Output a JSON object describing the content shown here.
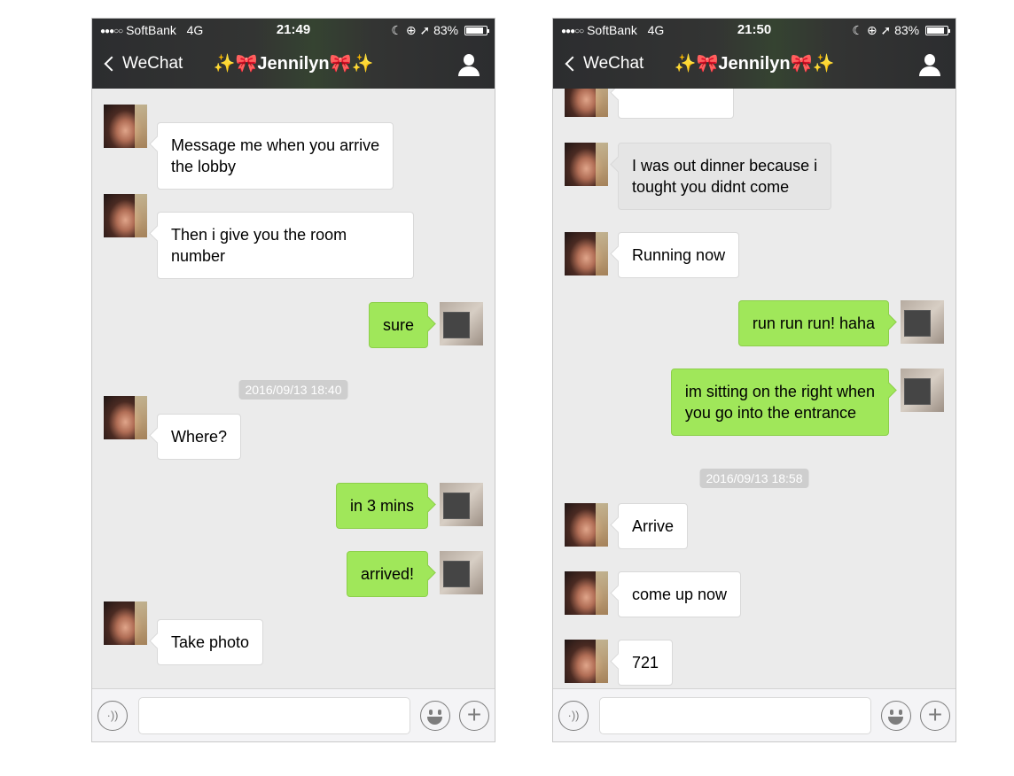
{
  "status_bar": {
    "carrier": "SoftBank",
    "network": "4G",
    "battery": "83%",
    "battery_level": 0.83
  },
  "screens": [
    {
      "time": "21:49",
      "nav": {
        "back_label": "WeChat",
        "title": "Jennilyn"
      },
      "messages": [
        {
          "from": "contact",
          "text": [
            "Message me when you arrive",
            "the lobby"
          ]
        },
        {
          "from": "contact",
          "text": [
            "Then i give you the room",
            "number"
          ]
        },
        {
          "from": "me",
          "text": [
            "sure"
          ]
        },
        {
          "timestamp": "2016/09/13 18:40"
        },
        {
          "from": "contact",
          "text": [
            "Where?"
          ]
        },
        {
          "from": "me",
          "text": [
            "in 3 mins"
          ]
        },
        {
          "from": "me",
          "text": [
            "arrived!"
          ]
        },
        {
          "from": "contact",
          "text": [
            "Take photo"
          ]
        }
      ]
    },
    {
      "time": "21:50",
      "nav": {
        "back_label": "WeChat",
        "title": "Jennilyn"
      },
      "messages": [
        {
          "from": "contact",
          "text": [
            "I was out dinner because i",
            "tought you didnt come"
          ]
        },
        {
          "from": "contact",
          "text": [
            "Running now"
          ]
        },
        {
          "from": "me",
          "text": [
            "run run run! haha"
          ]
        },
        {
          "from": "me",
          "text": [
            "im sitting on the right when",
            "you go into the entrance"
          ]
        },
        {
          "timestamp": "2016/09/13 18:58"
        },
        {
          "from": "contact",
          "text": [
            "Arrive"
          ]
        },
        {
          "from": "contact",
          "text": [
            "come up now"
          ]
        },
        {
          "from": "contact",
          "text": [
            "721"
          ]
        }
      ]
    }
  ],
  "icons": {
    "back": "chevron-left-icon",
    "profile": "person-icon",
    "voice": "voice-icon",
    "emoji": "emoji-icon",
    "plus": "plus-icon"
  },
  "colors": {
    "outgoing_bubble": "#a0e75a",
    "incoming_bubble": "#ffffff",
    "chat_background": "#ebebeb",
    "header": "#333433"
  }
}
